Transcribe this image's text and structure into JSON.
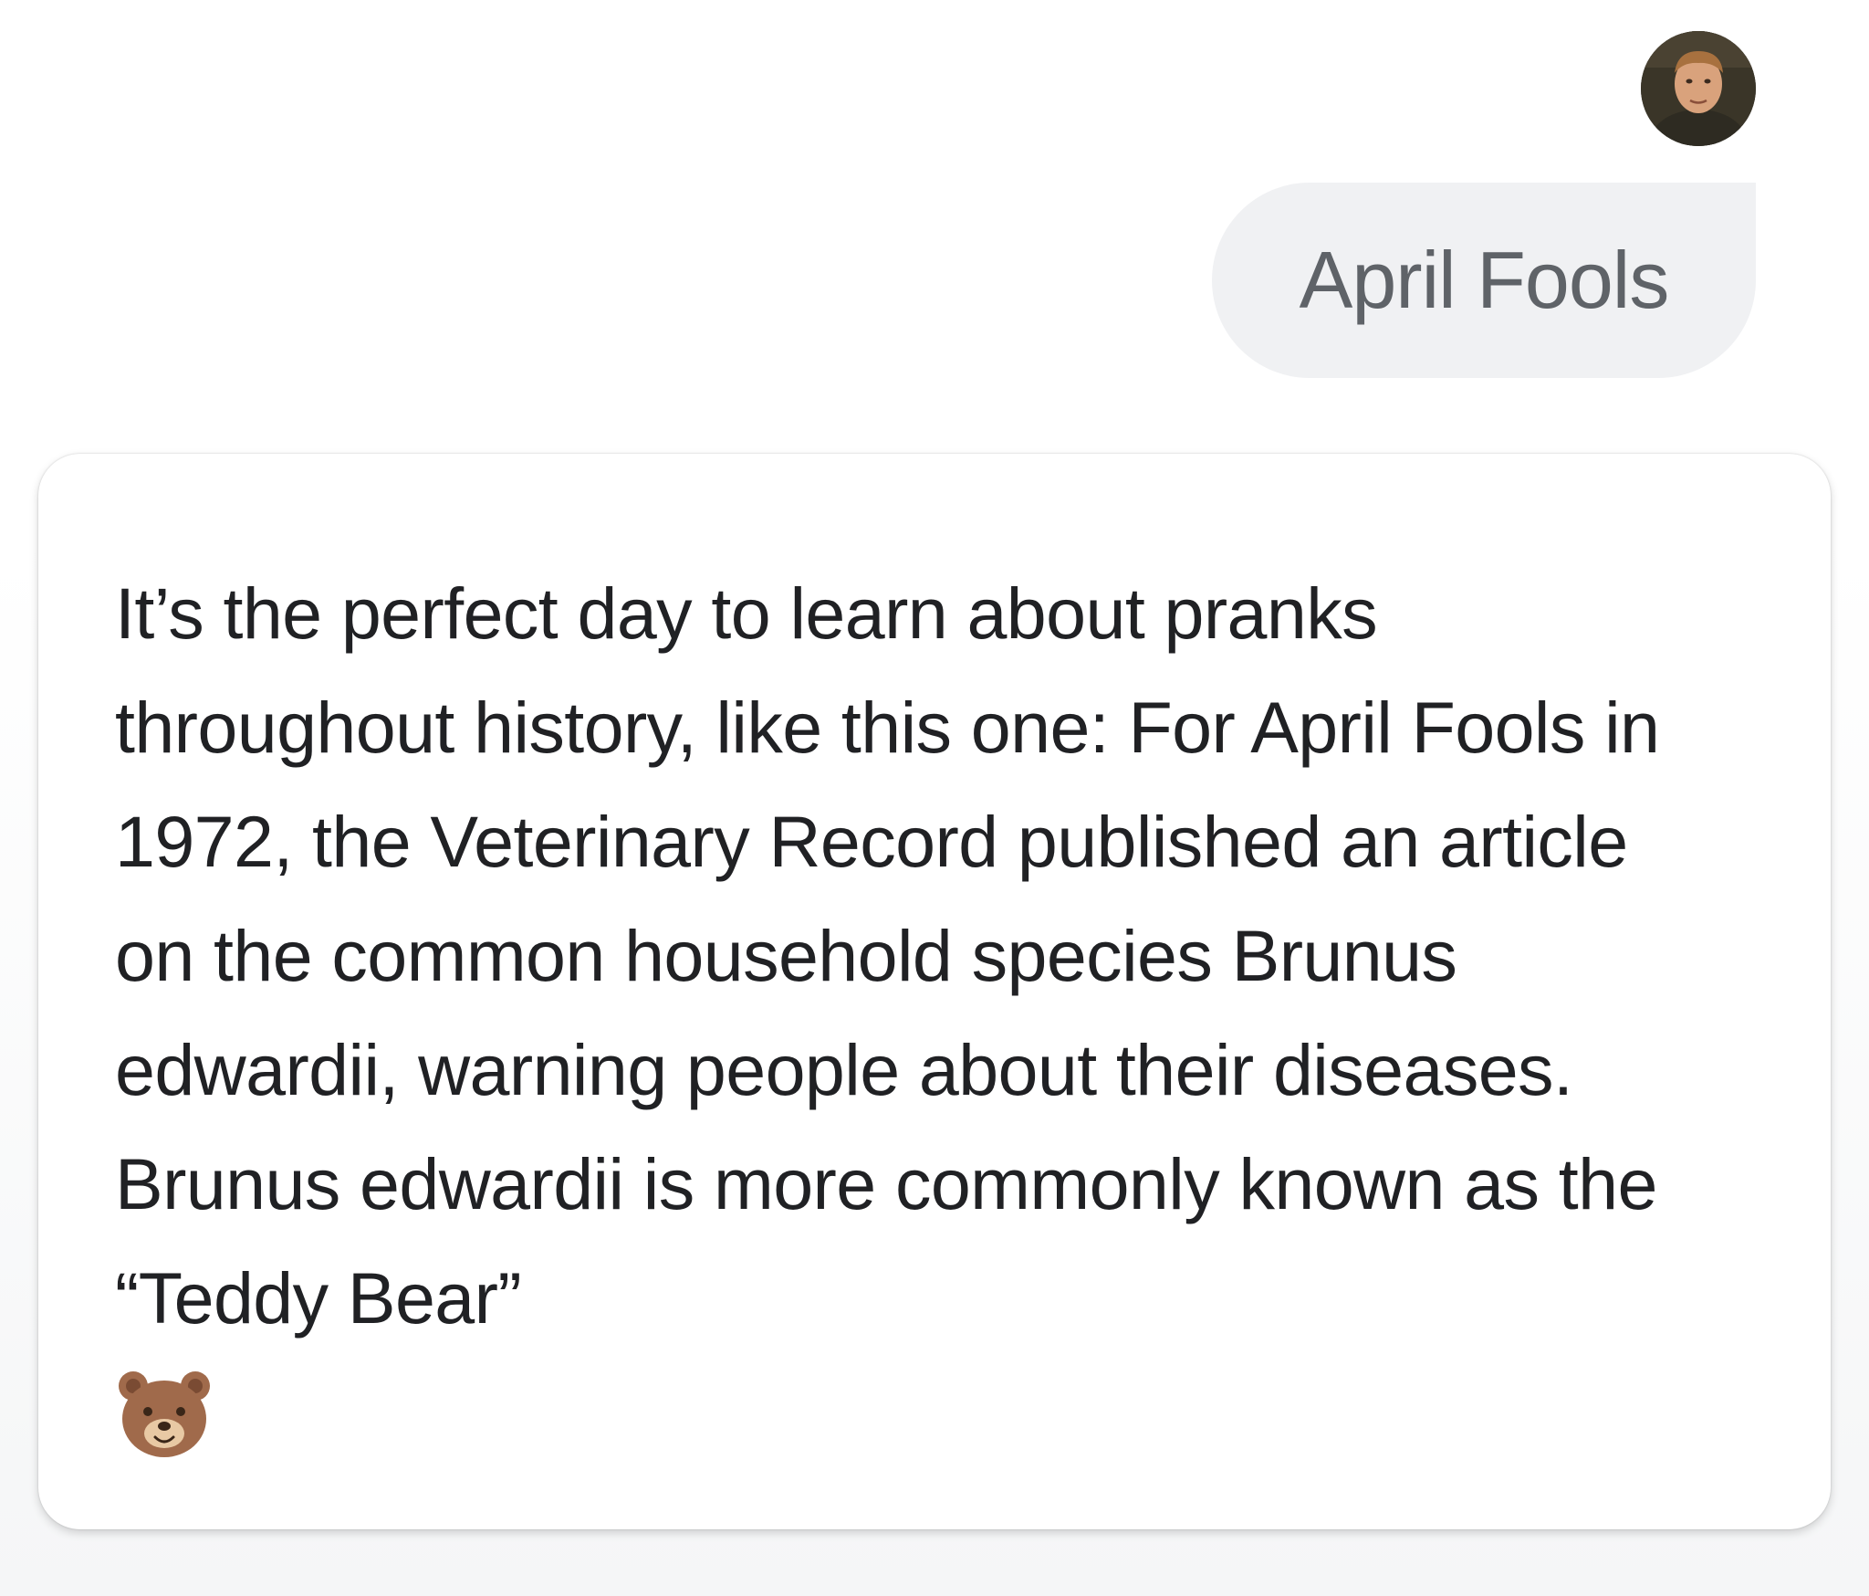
{
  "conversation": {
    "user_avatar_alt": "user avatar",
    "user_message": "April Fools",
    "assistant_reply": "It’s the perfect day to learn about pranks throughout history, like this one: For April Fools in 1972, the Veterinary Record pub­lished an article on the common household species Brunus edwardii, warning people about their diseases. Brunus edwardii is more commonly known as the “Teddy Bear”",
    "reply_emoji": "bear-face-icon"
  },
  "colors": {
    "user_bubble": "#f0f1f3",
    "user_text": "#5f6368",
    "reply_text": "#202124",
    "card_background": "#ffffff",
    "page_background": "#f5f6f7",
    "bear": "#a06a4b"
  }
}
